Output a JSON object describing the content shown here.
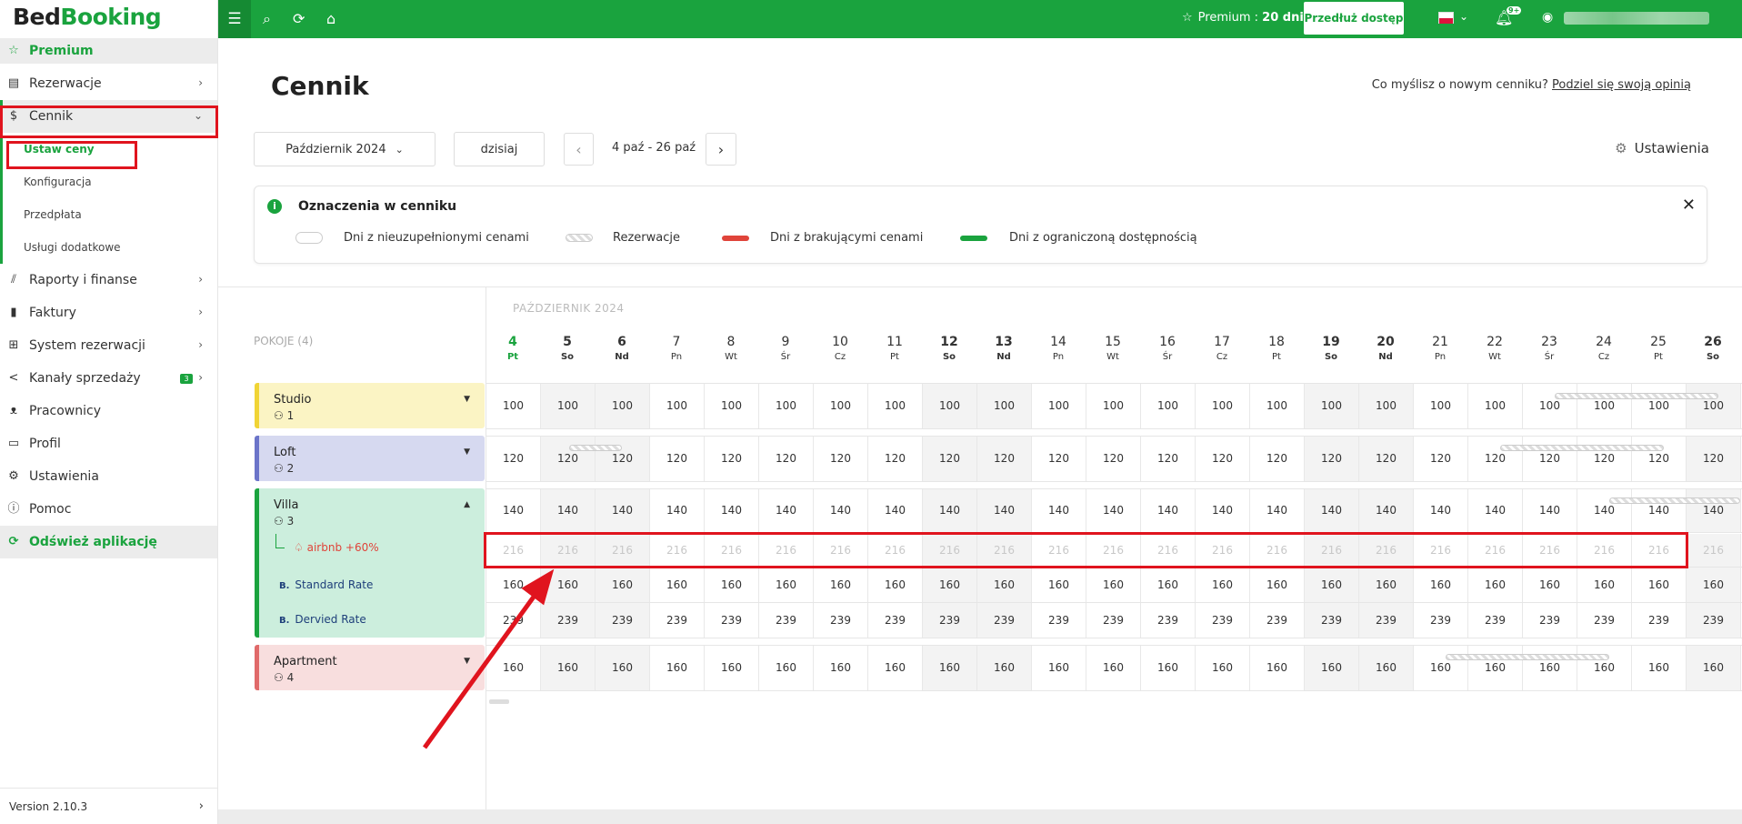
{
  "app": {
    "logo_a": "Bed",
    "logo_b": "Booking"
  },
  "sidebar": {
    "items": [
      {
        "label": "Premium",
        "icon": "star-icon"
      },
      {
        "label": "Rezerwacje",
        "icon": "calendar-icon"
      },
      {
        "label": "Cennik",
        "icon": "dollar-icon"
      },
      {
        "label": "Raporty i finanse",
        "icon": "chart-icon"
      },
      {
        "label": "Faktury",
        "icon": "invoice-icon"
      },
      {
        "label": "System rezerwacji",
        "icon": "grid-icon"
      },
      {
        "label": "Kanały sprzedaży",
        "icon": "share-icon",
        "badge": "3"
      },
      {
        "label": "Pracownicy",
        "icon": "users-icon"
      },
      {
        "label": "Profil",
        "icon": "profile-icon"
      },
      {
        "label": "Ustawienia",
        "icon": "gear-icon"
      },
      {
        "label": "Pomoc",
        "icon": "help-icon"
      },
      {
        "label": "Odśwież aplikację",
        "icon": "refresh-icon"
      }
    ],
    "sub_items": [
      "Ustaw ceny",
      "Konfiguracja",
      "Przedpłata",
      "Usługi dodatkowe"
    ],
    "version": "Version 2.10.3"
  },
  "topbar": {
    "premium_label": "Premium : ",
    "premium_days": "20 dni",
    "extend_button": "Przedłuż dostęp",
    "notif_badge": "9+"
  },
  "page": {
    "title": "Cennik",
    "feedback_text": "Co myślisz o nowym cenniku?",
    "feedback_link": "Podziel się swoją opinią",
    "month_select": "Październik 2024",
    "today_button": "dzisiaj",
    "date_range": "4 paź - 26 paź",
    "settings_label": "Ustawienia"
  },
  "legend": {
    "title": "Oznaczenia w cenniku",
    "items": [
      {
        "label": "Dni z nieuzupełnionymi cenami",
        "type": "empty"
      },
      {
        "label": "Rezerwacje",
        "type": "hatched"
      },
      {
        "label": "Dni z brakującymi cenami",
        "type": "red",
        "color": "#e0443a"
      },
      {
        "label": "Dni z ograniczoną dostępnością",
        "type": "green",
        "color": "#1aa33e"
      }
    ]
  },
  "grid": {
    "month_label": "PAŹDZIERNIK 2024",
    "rooms_label": "POKOJE (4)",
    "days": [
      {
        "n": "4",
        "d": "Pt",
        "today": true
      },
      {
        "n": "5",
        "d": "So",
        "weekend": true
      },
      {
        "n": "6",
        "d": "Nd",
        "weekend": true
      },
      {
        "n": "7",
        "d": "Pn"
      },
      {
        "n": "8",
        "d": "Wt"
      },
      {
        "n": "9",
        "d": "Śr"
      },
      {
        "n": "10",
        "d": "Cz"
      },
      {
        "n": "11",
        "d": "Pt"
      },
      {
        "n": "12",
        "d": "So",
        "weekend": true
      },
      {
        "n": "13",
        "d": "Nd",
        "weekend": true
      },
      {
        "n": "14",
        "d": "Pn"
      },
      {
        "n": "15",
        "d": "Wt"
      },
      {
        "n": "16",
        "d": "Śr"
      },
      {
        "n": "17",
        "d": "Cz"
      },
      {
        "n": "18",
        "d": "Pt"
      },
      {
        "n": "19",
        "d": "So",
        "weekend": true
      },
      {
        "n": "20",
        "d": "Nd",
        "weekend": true
      },
      {
        "n": "21",
        "d": "Pn"
      },
      {
        "n": "22",
        "d": "Wt"
      },
      {
        "n": "23",
        "d": "Śr"
      },
      {
        "n": "24",
        "d": "Cz"
      },
      {
        "n": "25",
        "d": "Pt"
      },
      {
        "n": "26",
        "d": "So",
        "weekend": true
      }
    ],
    "rooms": [
      {
        "name": "Studio",
        "capacity": "1",
        "color": "#fbf4c4",
        "border": "#f0d435",
        "price": "100"
      },
      {
        "name": "Loft",
        "capacity": "2",
        "color": "#d6d9f0",
        "border": "#6b74c9",
        "price": "120"
      },
      {
        "name": "Villa",
        "capacity": "3",
        "color": "#cceedd",
        "border": "#1aa33e",
        "price": "140",
        "channel": {
          "name": "airbnb",
          "modifier": "+60%",
          "price": "216"
        },
        "rates": [
          {
            "name": "Standard Rate",
            "price": "160",
            "mark": "B."
          },
          {
            "name": "Dervied Rate",
            "price": "239",
            "mark": "B."
          }
        ]
      },
      {
        "name": "Apartment",
        "capacity": "4",
        "color": "#f8dede",
        "border": "#e06a6a",
        "price": "160"
      }
    ]
  }
}
